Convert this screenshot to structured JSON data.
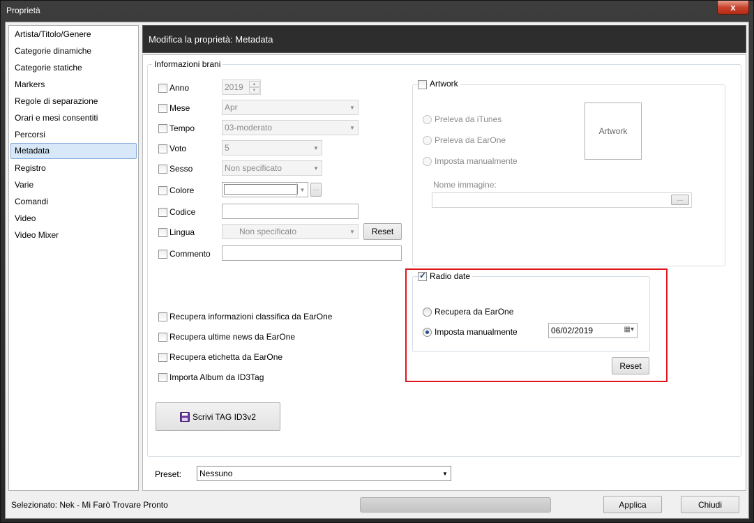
{
  "window": {
    "title": "Proprietà",
    "close_glyph": "x"
  },
  "sidebar": {
    "items": [
      {
        "label": "Artista/Titolo/Genere"
      },
      {
        "label": "Categorie dinamiche"
      },
      {
        "label": "Categorie statiche"
      },
      {
        "label": "Markers"
      },
      {
        "label": "Regole di separazione"
      },
      {
        "label": "Orari e mesi consentiti"
      },
      {
        "label": "Percorsi"
      },
      {
        "label": "Metadata",
        "selected": true
      },
      {
        "label": "Registro"
      },
      {
        "label": "Varie"
      },
      {
        "label": "Comandi"
      },
      {
        "label": "Video"
      },
      {
        "label": "Video Mixer"
      }
    ]
  },
  "header": {
    "title": "Modifica la proprietà: Metadata"
  },
  "info": {
    "group_label": "Informazioni brani",
    "anno": {
      "label": "Anno",
      "value": "2019"
    },
    "mese": {
      "label": "Mese",
      "value": "Apr"
    },
    "tempo": {
      "label": "Tempo",
      "value": "03-moderato"
    },
    "voto": {
      "label": "Voto",
      "value": "5"
    },
    "sesso": {
      "label": "Sesso",
      "value": "Non specificato"
    },
    "colore": {
      "label": "Colore",
      "value": "",
      "more_glyph": "···"
    },
    "codice": {
      "label": "Codice",
      "value": ""
    },
    "lingua": {
      "label": "Lingua",
      "value": "Non specificato",
      "reset_label": "Reset"
    },
    "commento": {
      "label": "Commento",
      "value": ""
    },
    "recupera_classifica": "Recupera informazioni classifica da EarOne",
    "recupera_news": "Recupera ultime news da EarOne",
    "recupera_etichetta": "Recupera etichetta da EarOne",
    "importa_album": "Importa Album da ID3Tag",
    "scrivi_tag_label": "Scrivi TAG ID3v2"
  },
  "artwork": {
    "label": "Artwork",
    "checked": false,
    "opt_itunes": "Preleva da iTunes",
    "opt_earone": "Preleva da EarOne",
    "opt_manual": "Imposta manualmente",
    "preview_label": "Artwork",
    "image_name_label": "Nome immagine:",
    "image_name_value": "",
    "browse_glyph": "···"
  },
  "radio_date": {
    "label": "Radio date",
    "checked": true,
    "opt_earone": "Recupera da EarOne",
    "opt_manual": "Imposta manualmente",
    "selected": "manual",
    "date_value": "06/02/2019",
    "reset_label": "Reset"
  },
  "preset": {
    "label": "Preset:",
    "value": "Nessuno"
  },
  "footer": {
    "status": "Selezionato: Nek - Mi Farò Trovare Pronto",
    "apply_label": "Applica",
    "close_label": "Chiudi"
  },
  "colors": {
    "accent_highlight": "#e0141c",
    "header_bg": "#2d2d2d",
    "selected_item_bg": "#d8e8f8"
  }
}
